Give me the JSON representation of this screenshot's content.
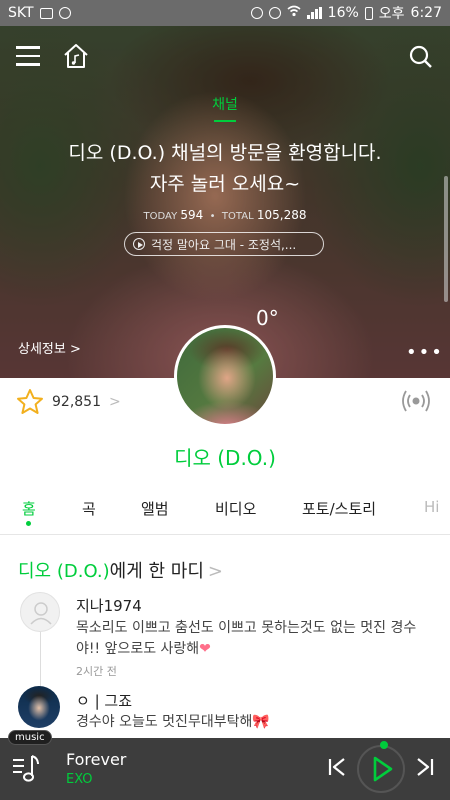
{
  "status_bar": {
    "carrier": "SKT",
    "battery": "16%",
    "ampm": "오후",
    "time": "6:27"
  },
  "hero": {
    "channel_label": "채널",
    "welcome_line1": "디오 (D.O.) 채널의 방문을 환영합니다.",
    "welcome_line2": "자주 놀러 오세요~",
    "today_label": "TODAY",
    "today_count": "594",
    "total_label": "TOTAL",
    "total_count": "105,288",
    "now_playing_pill": "걱정 말아요 그대 - 조정석,...",
    "temperature": "0°",
    "detail_link": "상세정보 >",
    "more": "•••"
  },
  "profile": {
    "likes": "92,851",
    "likes_chevron": ">",
    "artist_name": "디오 (D.O.)"
  },
  "tabs": [
    {
      "label": "홈",
      "active": true
    },
    {
      "label": "곡"
    },
    {
      "label": "앨범"
    },
    {
      "label": "비디오"
    },
    {
      "label": "포토/스토리"
    },
    {
      "label": "Hi"
    }
  ],
  "comments_section": {
    "title_highlight": "디오 (D.O.)",
    "title_rest": "에게 한 마디",
    "chevron": ">",
    "comments": [
      {
        "user": "지나1974",
        "text": "목소리도 이쁘고 춤선도 이쁘고 못하는것도 없는 멋진 경수야!! 앞으로도 사랑해",
        "emoji": "❤",
        "time": "2시간 전"
      },
      {
        "user": "ㅇ | 그죠",
        "text": "경수야 오늘도 멋진무대부탁해",
        "emoji": "🎀"
      }
    ]
  },
  "player": {
    "badge": "music",
    "title": "Forever",
    "artist": "EXO"
  },
  "colors": {
    "accent": "#00cd3c",
    "player_bg": "#3d3d3d",
    "status_bar": "#6b6b6b"
  }
}
